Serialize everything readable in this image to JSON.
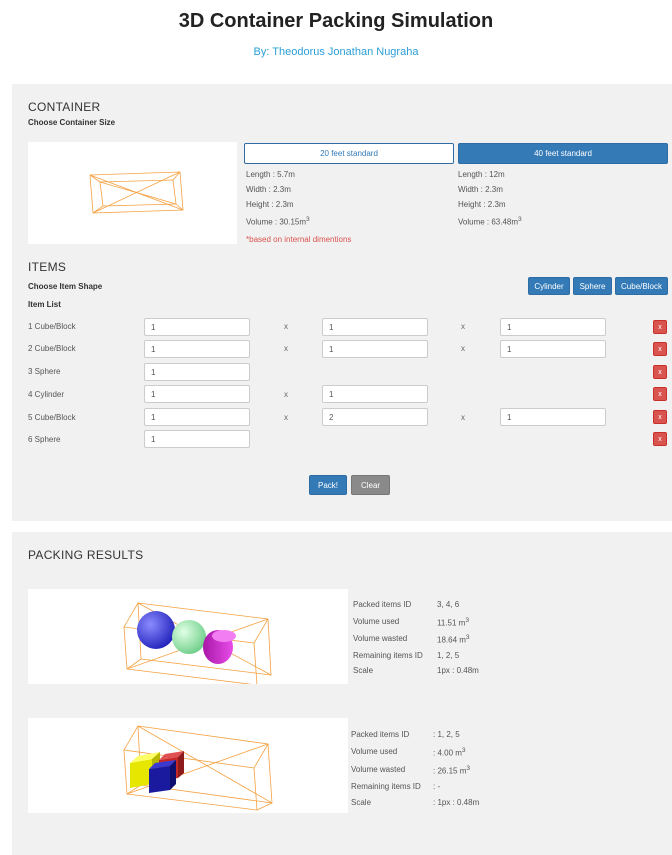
{
  "header": {
    "title": "3D Container Packing Simulation",
    "byline": "By: Theodorus Jonathan Nugraha"
  },
  "container": {
    "section_title": "CONTAINER",
    "subtitle": "Choose Container Size",
    "options": [
      {
        "button": "20 feet standard",
        "length": "Length : 5.7m",
        "width": "Width : 2.3m",
        "height": "Height : 2.3m",
        "volume_label": "Volume : 30.15m",
        "volume_sup": "3"
      },
      {
        "button": "40 feet standard",
        "length": "Length : 12m",
        "width": "Width : 2.3m",
        "height": "Height : 2.3m",
        "volume_label": "Volume : 63.48m",
        "volume_sup": "3"
      }
    ],
    "note": "*based on internal dimentions"
  },
  "items": {
    "section_title": "ITEMS",
    "shape_label": "Choose Item Shape",
    "list_label": "Item List",
    "shape_buttons": [
      "Cylinder",
      "Sphere",
      "Cube/Block"
    ],
    "times": "x",
    "delete_label": "x",
    "rows": [
      {
        "label": "1  Cube/Block",
        "v1": "1",
        "v2": "1",
        "v3": "1"
      },
      {
        "label": "2  Cube/Block",
        "v1": "1",
        "v2": "1",
        "v3": "1"
      },
      {
        "label": "3  Sphere",
        "v1": "1"
      },
      {
        "label": "4  Cylinder",
        "v1": "1",
        "v2": "1"
      },
      {
        "label": "5  Cube/Block",
        "v1": "1",
        "v2": "2",
        "v3": "1"
      },
      {
        "label": "6  Sphere",
        "v1": "1"
      }
    ],
    "pack_button": "Pack!",
    "clear_button": "Clear"
  },
  "results": {
    "section_title": "PACKING RESULTS",
    "entries": [
      {
        "packed_label": "Packed items ID",
        "packed_value": "3, 4, 6",
        "used_label": "Volume used",
        "used_value": "11.51 m",
        "used_sup": "3",
        "wasted_label": "Volume wasted",
        "wasted_value": "18.64 m",
        "wasted_sup": "3",
        "remaining_label": "Remaining items ID",
        "remaining_value": "1, 2, 5",
        "scale_label": "Scale",
        "scale_value": "1px : 0.48m"
      },
      {
        "packed_label": "Packed items ID",
        "packed_value": ": 1, 2, 5",
        "used_label": "Volume used",
        "used_value": ": 4.00 m",
        "used_sup": "3",
        "wasted_label": "Volume wasted",
        "wasted_value": ": 26.15 m",
        "wasted_sup": "3",
        "remaining_label": "Remaining items ID",
        "remaining_value": ": -",
        "scale_label": "Scale",
        "scale_value": ": 1px : 0.48m"
      }
    ]
  },
  "colors": {
    "accent": "#337ab7",
    "byline": "#2a9fd6",
    "danger": "#d9534f",
    "wireframe": "#f5a142",
    "panel": "#f1f1f1"
  }
}
